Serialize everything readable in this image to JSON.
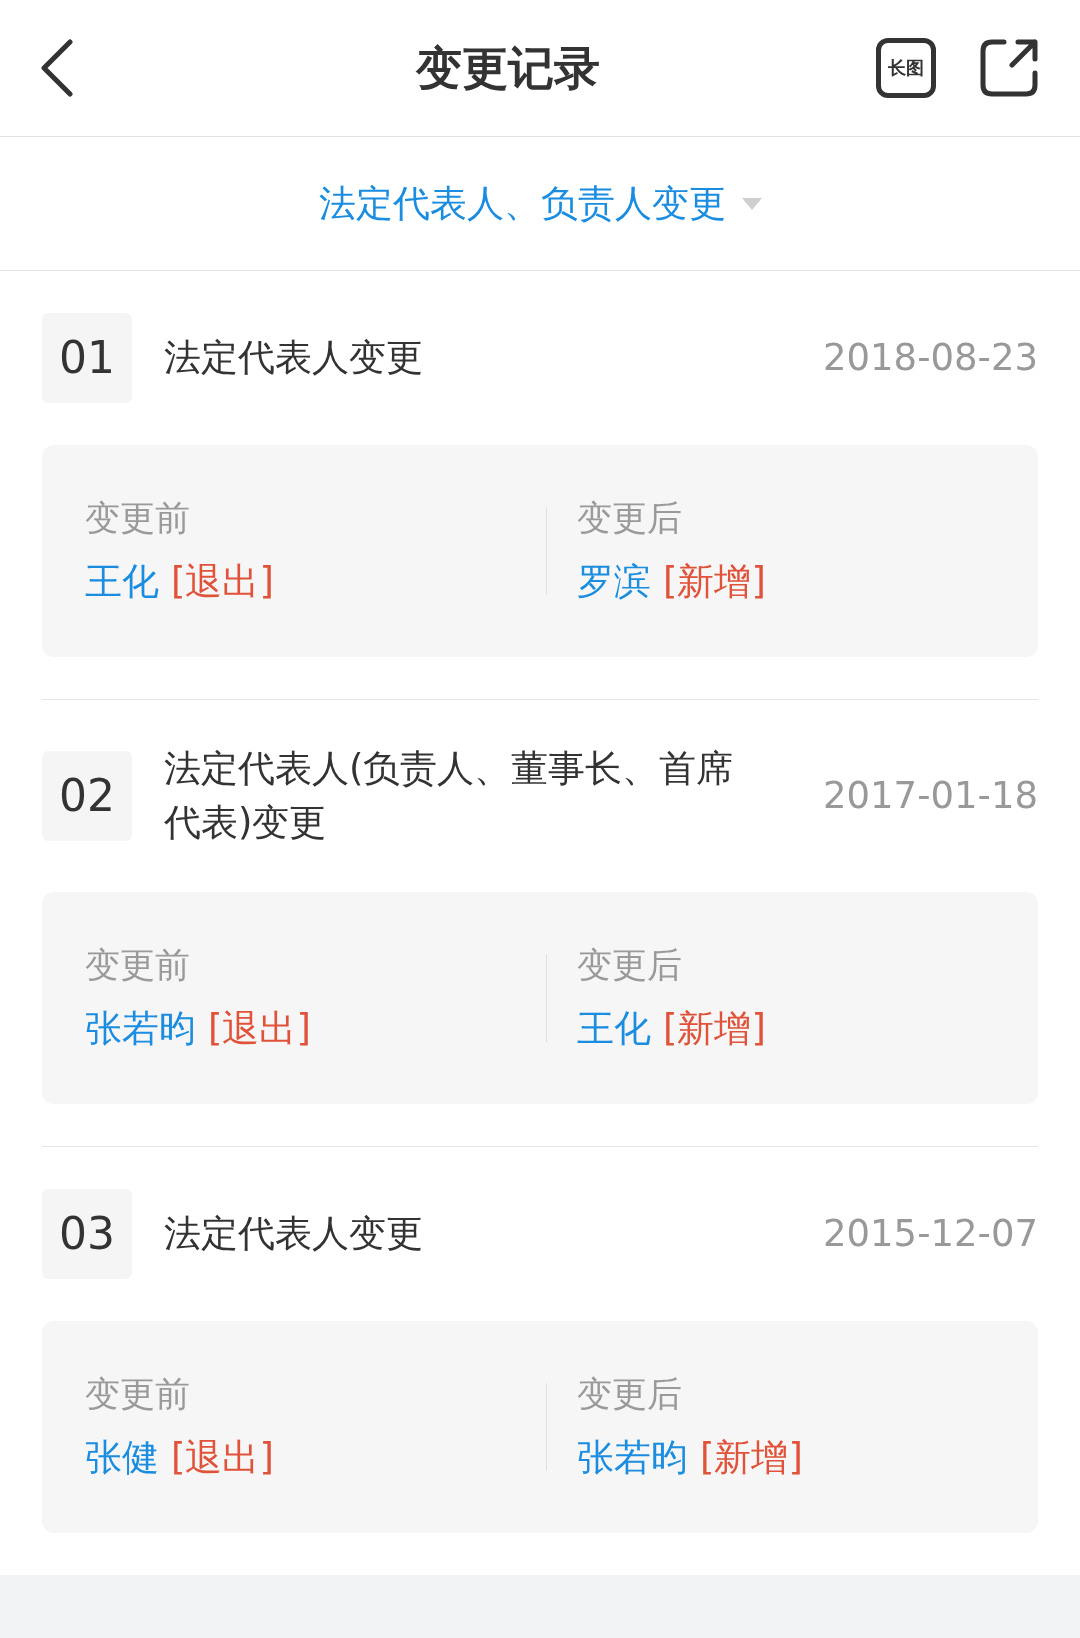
{
  "header": {
    "title": "变更记录",
    "long_image_label": "长图"
  },
  "filter": {
    "label": "法定代表人、负责人变更"
  },
  "records": [
    {
      "number": "01",
      "title": "法定代表人变更",
      "date": "2018-08-23",
      "before": {
        "label": "变更前",
        "name": "王化",
        "tag": "[退出]"
      },
      "after": {
        "label": "变更后",
        "name": "罗滨",
        "tag": "[新增]"
      }
    },
    {
      "number": "02",
      "title": "法定代表人(负责人、董事长、首席代表)变更",
      "date": "2017-01-18",
      "before": {
        "label": "变更前",
        "name": "张若昀",
        "tag": "[退出]"
      },
      "after": {
        "label": "变更后",
        "name": "王化",
        "tag": "[新增]"
      }
    },
    {
      "number": "03",
      "title": "法定代表人变更",
      "date": "2015-12-07",
      "before": {
        "label": "变更前",
        "name": "张健",
        "tag": "[退出]"
      },
      "after": {
        "label": "变更后",
        "name": "张若昀",
        "tag": "[新增]"
      }
    }
  ]
}
